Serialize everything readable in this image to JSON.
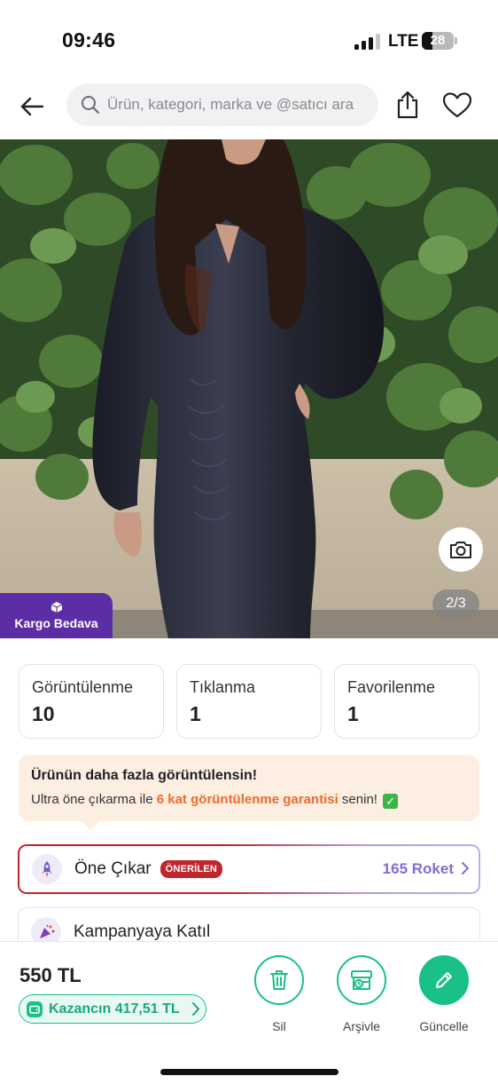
{
  "status_bar": {
    "time": "09:46",
    "network": "LTE",
    "battery": "28"
  },
  "search": {
    "placeholder": "Ürün, kategori, marka ve @satıcı ara"
  },
  "product": {
    "badge": "Kargo Bedava",
    "image_counter": "2/3"
  },
  "stats": [
    {
      "label": "Görüntülenme",
      "value": "10"
    },
    {
      "label": "Tıklanma",
      "value": "1"
    },
    {
      "label": "Favorilenme",
      "value": "1"
    }
  ],
  "promo": {
    "title": "Ürünün daha fazla görüntülensin!",
    "text_before": "Ultra öne çıkarma ile ",
    "highlight": "6 kat görüntülenme garantisi",
    "text_after": " senin!"
  },
  "boost": {
    "label": "Öne Çıkar",
    "badge": "ÖNERİLEN",
    "price": "165 Roket"
  },
  "campaign": {
    "label": "Kampanyaya Katıl"
  },
  "bottom": {
    "price": "550 TL",
    "earnings": "Kazancın 417,51 TL",
    "actions": {
      "delete": "Sil",
      "archive": "Arşivle",
      "update": "Güncelle"
    }
  },
  "colors": {
    "brand_green": "#1ac08a",
    "brand_purple": "#5b2ea6",
    "accent_red": "#c0262b",
    "highlight_orange": "#ef6b2d",
    "rocket_purple": "#7d6fd2"
  }
}
